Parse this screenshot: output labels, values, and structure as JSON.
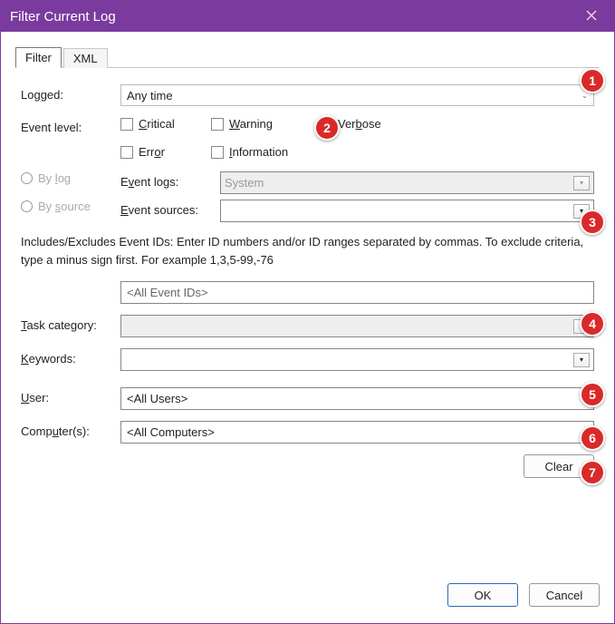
{
  "window": {
    "title": "Filter Current Log"
  },
  "tabs": {
    "filter": "Filter",
    "xml": "XML"
  },
  "labels": {
    "logged": "Logged:",
    "event_level": "Event level:",
    "by_log": "By log",
    "by_source": "By source",
    "event_logs": "Event logs:",
    "event_sources": "Event sources:",
    "task_category": "Task category:",
    "keywords": "Keywords:",
    "user": "User:",
    "computers": "Computer(s):"
  },
  "underline": {
    "by_log": "l",
    "by_source": "s",
    "event_logs": "v",
    "event_sources": "E",
    "task_category": "T",
    "keywords": "K",
    "user": "U",
    "computers": "u"
  },
  "logged_value": "Any time",
  "levels": {
    "critical": "Critical",
    "warning": "Warning",
    "verbose": "Verbose",
    "error": "Error",
    "information": "Information"
  },
  "event_logs_value": "System",
  "event_sources_value": "",
  "instruction": "Includes/Excludes Event IDs: Enter ID numbers and/or ID ranges separated by commas. To exclude criteria, type a minus sign first. For example 1,3,5-99,-76",
  "event_ids_placeholder": "<All Event IDs>",
  "task_category_value": "",
  "keywords_value": "",
  "user_value": "<All Users>",
  "computers_value": "<All Computers>",
  "buttons": {
    "clear": "Clear",
    "ok": "OK",
    "cancel": "Cancel"
  },
  "annotations": [
    "1",
    "2",
    "3",
    "4",
    "5",
    "6",
    "7"
  ]
}
